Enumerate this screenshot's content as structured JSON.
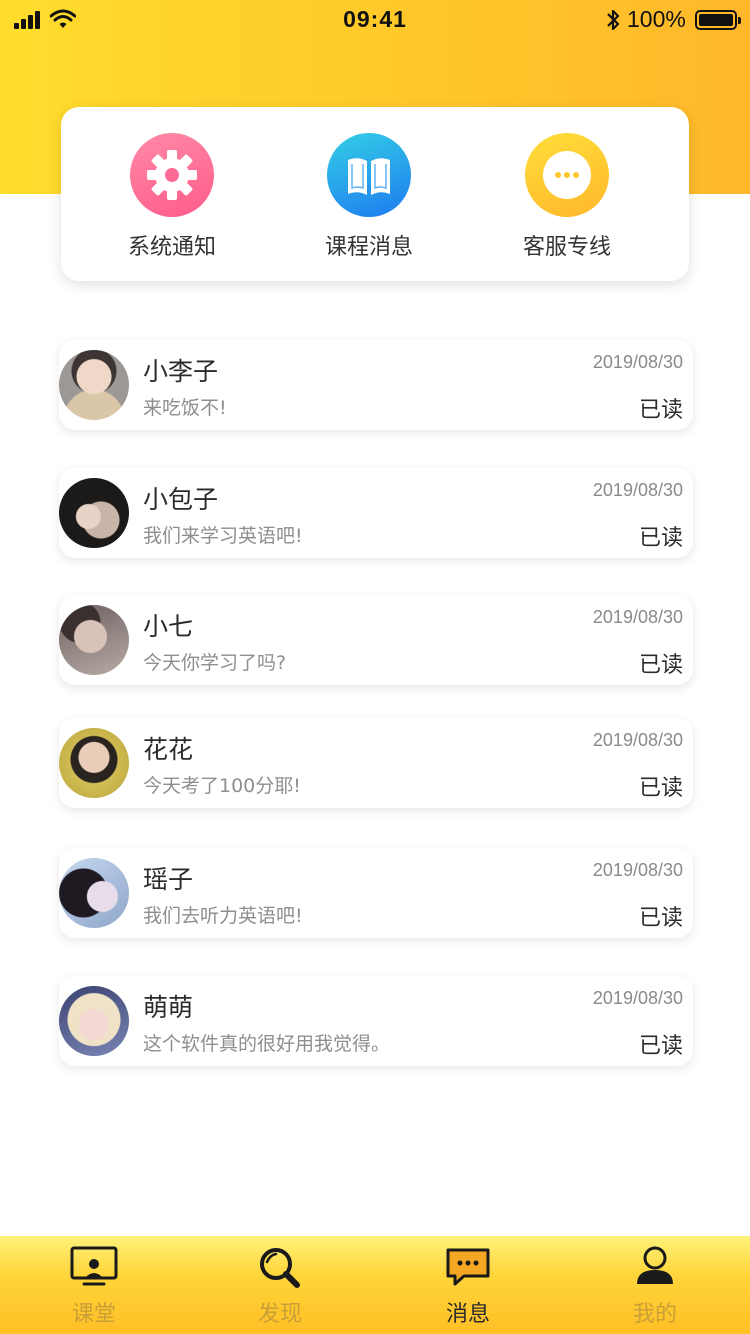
{
  "status_bar": {
    "time": "09:41",
    "battery": "100%"
  },
  "shortcuts": [
    {
      "label": "系统通知",
      "icon": "gear-icon",
      "color": "#ff6b95"
    },
    {
      "label": "课程消息",
      "icon": "book-icon",
      "color": "#1e90f0"
    },
    {
      "label": "客服专线",
      "icon": "more-dots-icon",
      "color": "#ffc62e"
    }
  ],
  "messages": [
    {
      "name": "小李子",
      "text": "来吃饭不!",
      "date": "2019/08/30",
      "status": "已读"
    },
    {
      "name": "小包子",
      "text": "我们来学习英语吧!",
      "date": "2019/08/30",
      "status": "已读"
    },
    {
      "name": "小七",
      "text": "今天你学习了吗?",
      "date": "2019/08/30",
      "status": "已读"
    },
    {
      "name": "花花",
      "text": "今天考了100分耶!",
      "date": "2019/08/30",
      "status": "已读"
    },
    {
      "name": "瑶子",
      "text": "我们去听力英语吧!",
      "date": "2019/08/30",
      "status": "已读"
    },
    {
      "name": "萌萌",
      "text": "这个软件真的很好用我觉得。",
      "date": "2019/08/30",
      "status": "已读"
    }
  ],
  "tabs": [
    {
      "label": "课堂",
      "icon": "classroom-icon",
      "active": false
    },
    {
      "label": "发现",
      "icon": "search-icon",
      "active": false
    },
    {
      "label": "消息",
      "icon": "message-icon",
      "active": true
    },
    {
      "label": "我的",
      "icon": "profile-icon",
      "active": false
    }
  ],
  "colors": {
    "header": "#ffc82a",
    "tab_inactive": "#c99f37",
    "tab_active": "#2b2b2b"
  }
}
